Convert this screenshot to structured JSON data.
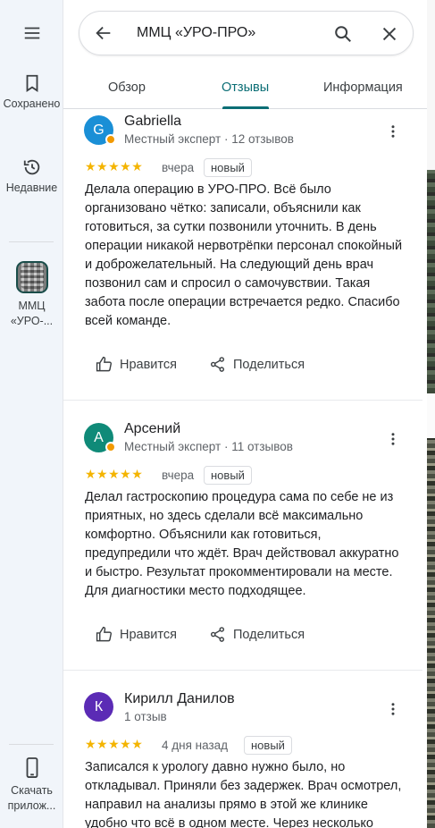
{
  "rail": {
    "menu_icon": "menu-icon",
    "saved_label": "Сохранено",
    "recent_label": "Недавние",
    "place_label": "ММЦ «УРО-...",
    "download_label": "Скачать прилож..."
  },
  "search": {
    "query": "ММЦ «УРО-ПРО»"
  },
  "tabs": [
    {
      "label": "Обзор"
    },
    {
      "label": "Отзывы"
    },
    {
      "label": "Информация"
    }
  ],
  "colors": {
    "accent": "#0b6e75",
    "star": "#f4b400"
  },
  "reviews": [
    {
      "initial": "G",
      "avatar_color": "#1a8fd6",
      "name": "Gabriella",
      "meta": "Местный эксперт · 12 отзывов",
      "stars": "★★★★★",
      "date": "вчера",
      "tag": "новый",
      "text": "Делала операцию в УРО-ПРО. Всё было организовано чётко: записали, объяснили как готовиться, за сутки позвонили уточнить. В день операции никакой нервотрёпки персонал спокойный и доброжелательный. На следующий день врач позвонил сам и спросил о самочувствии. Такая забота после операции встречается редко. Спасибо всей команде.",
      "like": "Нравится",
      "share": "Поделиться"
    },
    {
      "initial": "А",
      "avatar_color": "#0f8a78",
      "name": "Арсений",
      "meta": "Местный эксперт · 11 отзывов",
      "stars": "★★★★★",
      "date": "вчера",
      "tag": "новый",
      "text": "Делал гастроскопию   процедура сама по себе не из приятных, но здесь сделали всё максимально комфортно. Объяснили как готовиться, предупредили что ждёт. Врач действовал аккуратно и быстро. Результат прокомментировали на месте. Для диагностики место подходящее.",
      "like": "Нравится",
      "share": "Поделиться"
    },
    {
      "initial": "К",
      "avatar_color": "#5b2bb5",
      "name": "Кирилл Данилов",
      "meta": "1 отзыв",
      "stars": "★★★★★",
      "date": "4 дня назад",
      "tag": "новый",
      "text": "Записался к урологу давно нужно было, но откладывал. Приняли без задержек. Врач осмотрел, направил на анализы прямо в этой же клинике удобно что всё в одном месте. Через несколько"
    }
  ]
}
